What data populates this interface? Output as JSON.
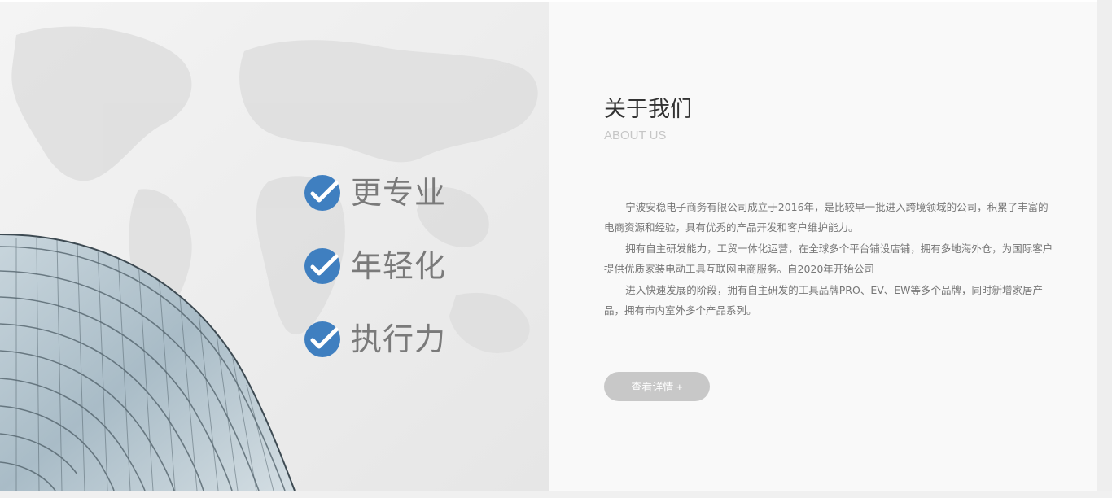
{
  "features": [
    {
      "label": "更专业",
      "icon": "check-circle-icon"
    },
    {
      "label": "年轻化",
      "icon": "check-circle-icon"
    },
    {
      "label": "执行力",
      "icon": "check-circle-icon"
    }
  ],
  "about": {
    "title": "关于我们",
    "subtitle": "ABOUT US",
    "paragraphs": [
      "宁波安稳电子商务有限公司成立于2016年，是比较早一批进入跨境领域的公司，积累了丰富的电商资源和经验，具有优秀的产品开发和客户维护能力。",
      "拥有自主研发能力，工贸一体化运营，在全球多个平台铺设店铺，拥有多地海外仓，为国际客户提供优质家装电动工具互联网电商服务。自2020年开始公司",
      "进入快速发展的阶段，拥有自主研发的工具品牌PRO、EV、EW等多个品牌，同时新增家居产品，拥有市内室外多个产品系列。"
    ],
    "button_label": "查看详情 +"
  },
  "colors": {
    "accent_blue": "#3f7fc0",
    "button_gray": "#c8c8c8"
  }
}
